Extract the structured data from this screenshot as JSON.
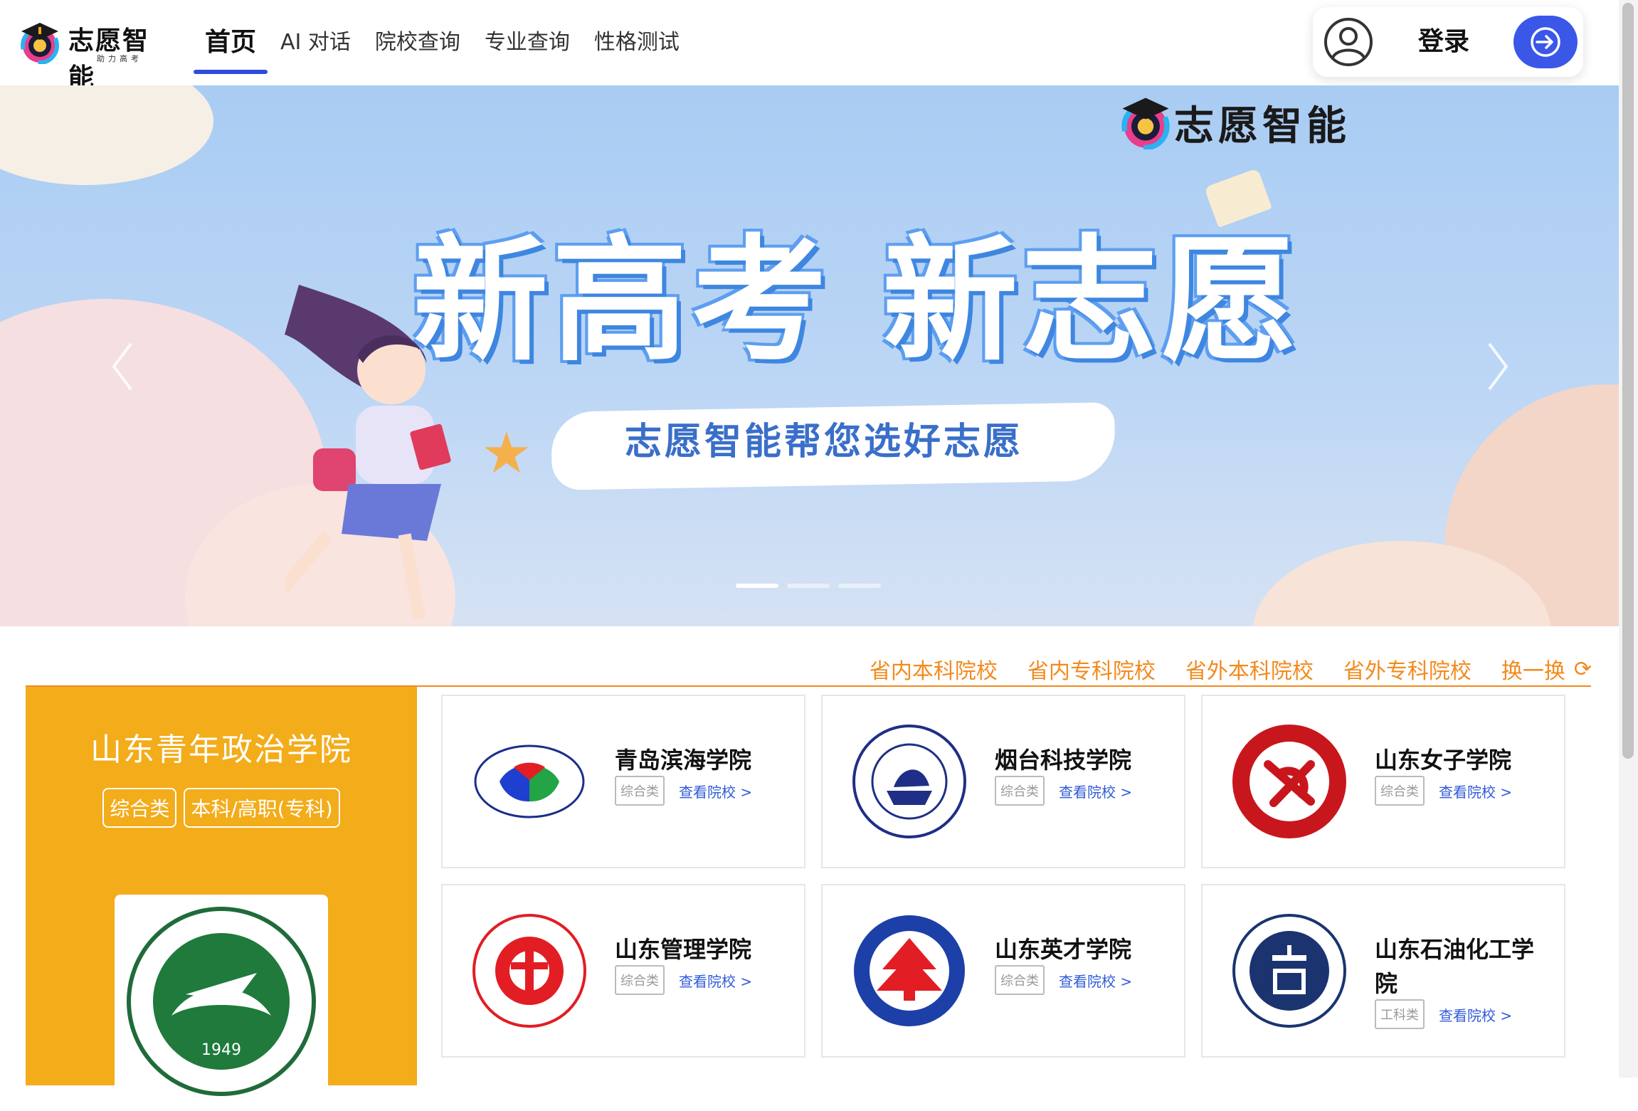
{
  "header": {
    "logo_text": "志愿智能",
    "logo_sub": "助力高考",
    "nav": [
      "首页",
      "AI 对话",
      "院校查询",
      "专业查询",
      "性格测试"
    ],
    "login_label": "登录"
  },
  "banner": {
    "logo_text": "志愿智能",
    "headline": "新高考 新志愿",
    "subline": "志愿智能帮您选好志愿",
    "slides_count": 3,
    "active_slide": 1
  },
  "categories": {
    "tabs": [
      "省内本科院校",
      "省内专科院校",
      "省外本科院校",
      "省外专科院校"
    ],
    "refresh_label": "换一换"
  },
  "featured": {
    "name": "山东青年政治学院",
    "tags": [
      "综合类",
      "本科/高职(专科)"
    ],
    "logo_year": "1949"
  },
  "schools": [
    {
      "name": "青岛滨海学院",
      "tag": "综合类",
      "link": "查看院校 >",
      "logo_color": "#1a2f8a"
    },
    {
      "name": "烟台科技学院",
      "tag": "综合类",
      "link": "查看院校 >",
      "logo_color": "#1f2f87"
    },
    {
      "name": "山东女子学院",
      "tag": "综合类",
      "link": "查看院校 >",
      "logo_color": "#c8161d"
    },
    {
      "name": "山东管理学院",
      "tag": "综合类",
      "link": "查看院校 >",
      "logo_color": "#e21d24"
    },
    {
      "name": "山东英才学院",
      "tag": "综合类",
      "link": "查看院校 >",
      "logo_color": "#1d3fa8"
    },
    {
      "name": "山东石油化工学院",
      "tag": "工科类",
      "link": "查看院校 >",
      "logo_color": "#1b3470"
    }
  ]
}
